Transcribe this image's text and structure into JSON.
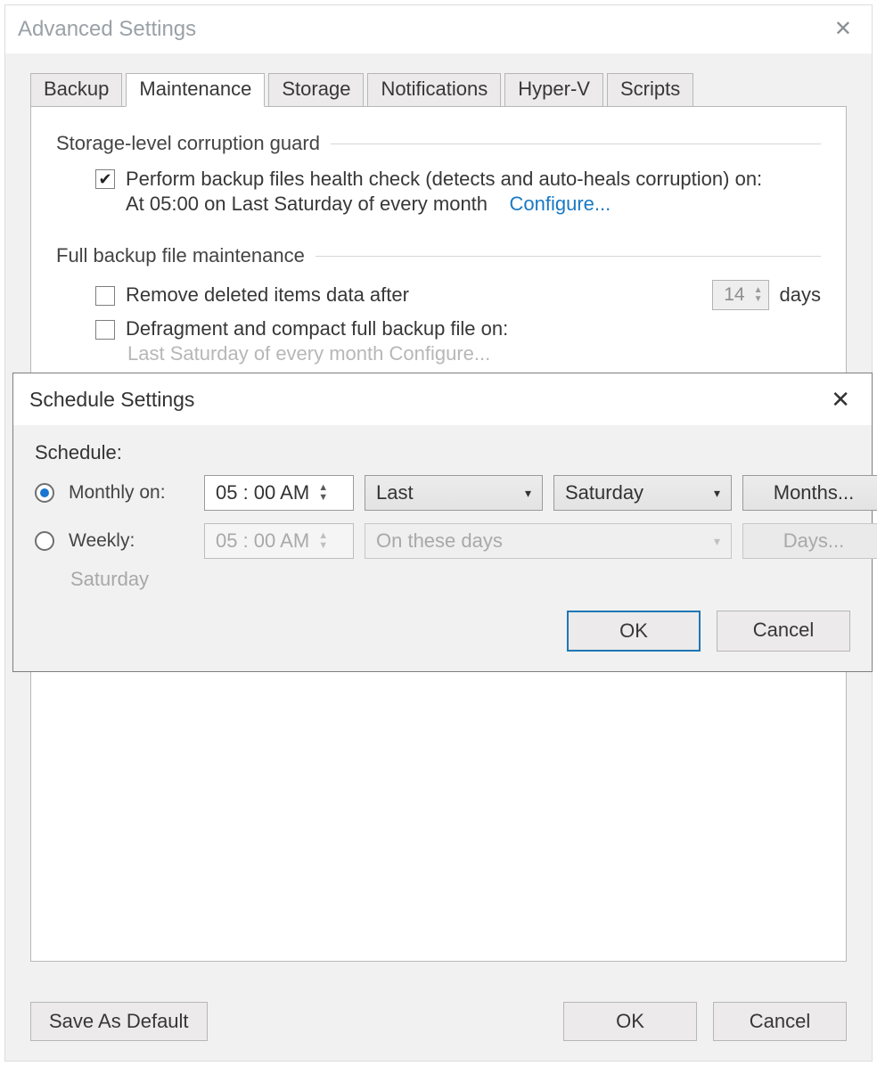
{
  "window": {
    "title": "Advanced Settings"
  },
  "tabs": [
    "Backup",
    "Maintenance",
    "Storage",
    "Notifications",
    "Hyper-V",
    "Scripts"
  ],
  "group1_title": "Storage-level corruption guard",
  "health_check": {
    "line1": "Perform backup files health check (detects and auto-heals corruption) on:",
    "line2_prefix": "At 05:00 on Last Saturday of every month",
    "configure": "Configure..."
  },
  "group2_title": "Full backup file maintenance",
  "remove_label": "Remove deleted items data after",
  "remove_days_value": "14",
  "remove_days_suffix": "days",
  "defrag_label": "Defragment and compact full backup file on:",
  "defrag_ghost": "Last Saturday of every month  Configure...",
  "footer": {
    "save_default": "Save As Default",
    "ok": "OK",
    "cancel": "Cancel"
  },
  "modal": {
    "title": "Schedule Settings",
    "schedule_label": "Schedule:",
    "monthly_label": "Monthly on:",
    "weekly_label": "Weekly:",
    "monthly_time": "05 : 00 AM",
    "monthly_ordinal": "Last",
    "monthly_day": "Saturday",
    "months_btn": "Months...",
    "weekly_time": "05 : 00 AM",
    "weekly_days_placeholder": "On these days",
    "days_btn": "Days...",
    "weekly_hint": "Saturday",
    "ok": "OK",
    "cancel": "Cancel"
  }
}
